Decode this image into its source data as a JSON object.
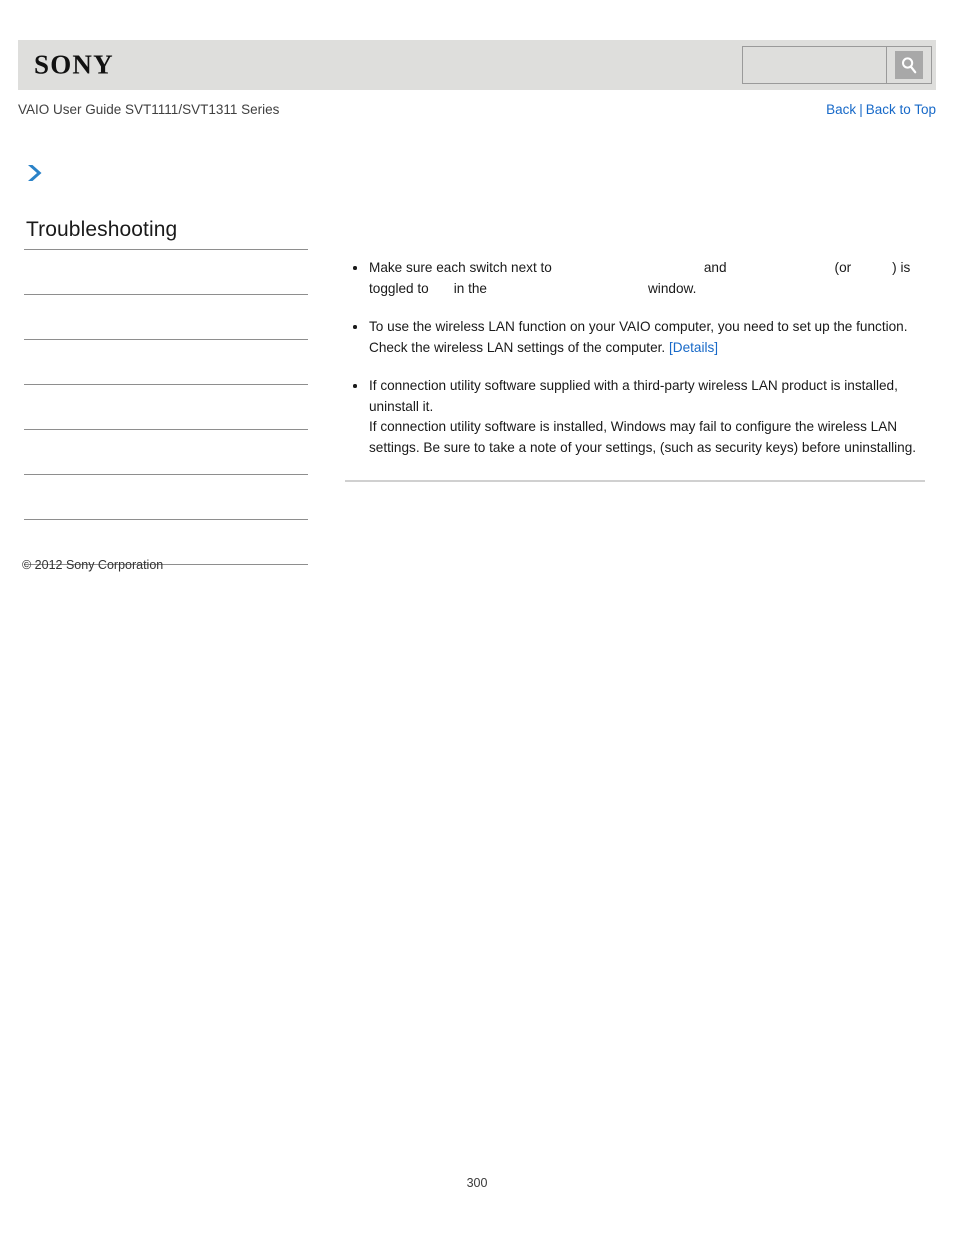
{
  "header": {
    "logo_text": "SONY",
    "search": {
      "value": "",
      "placeholder": "",
      "icon": "search-icon",
      "button_label": ""
    }
  },
  "breadcrumb": {
    "guide_title": "VAIO User Guide SVT1111/SVT1311 Series",
    "back_label": "Back",
    "separator": "|",
    "back_to_top_label": "Back to Top"
  },
  "page_marker": {
    "icon": "chevron-right-icon"
  },
  "sidebar": {
    "title": "Troubleshooting",
    "items": [
      {
        "label": ""
      },
      {
        "label": ""
      },
      {
        "label": ""
      },
      {
        "label": ""
      },
      {
        "label": ""
      },
      {
        "label": ""
      },
      {
        "label": ""
      }
    ]
  },
  "content": {
    "bullets": [
      {
        "parts": [
          {
            "type": "text",
            "value": "Make sure each switch next to"
          },
          {
            "type": "gap",
            "size": "a"
          },
          {
            "type": "text",
            "value": "and"
          },
          {
            "type": "gap",
            "size": "b"
          },
          {
            "type": "text",
            "value": "(or"
          },
          {
            "type": "gap",
            "size": "c"
          },
          {
            "type": "text",
            "value": ") is toggled to"
          },
          {
            "type": "gap",
            "size": "d"
          },
          {
            "type": "text",
            "value": "in the"
          },
          {
            "type": "gap",
            "size": "e"
          },
          {
            "type": "text",
            "value": "window."
          }
        ],
        "line1_a": "Make sure each switch next to",
        "line1_b": "and",
        "line1_c": "(or",
        "line1_d": ") is",
        "line2_a": "toggled to",
        "line2_b": "in the",
        "line2_c": "window."
      },
      {
        "line1": "To use the wireless LAN function on your VAIO computer, you need to set up the function.",
        "line2": "Check the wireless LAN settings of the computer.",
        "link_label": "[Details]"
      },
      {
        "line1": "If connection utility software supplied with a third-party wireless LAN product is installed, uninstall it.",
        "line2": "If connection utility software is installed, Windows may fail to configure the wireless LAN settings. Be sure to take a note of your settings, (such as security keys) before uninstalling."
      }
    ]
  },
  "footer": {
    "copyright": "© 2012 Sony Corporation",
    "page_number": "300"
  },
  "colors": {
    "link": "#1769c8",
    "header_band": "#dededc",
    "chevron": "#2a82c8",
    "rule": "#8e8e8e"
  }
}
